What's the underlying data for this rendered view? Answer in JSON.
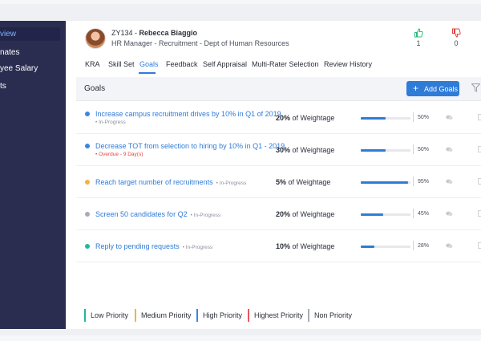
{
  "sidebar": {
    "items": [
      {
        "label": "view",
        "active": true
      },
      {
        "label": "nates",
        "active": false
      },
      {
        "label": "yee Salary",
        "active": false
      },
      {
        "label": "ts",
        "active": false
      }
    ]
  },
  "employee": {
    "id": "ZY134",
    "separator": " - ",
    "name": "Rebecca Biaggio",
    "role": "HR Manager - Recruitment - Dept of Human Resources"
  },
  "feedback": {
    "likes": "1",
    "dislikes": "0"
  },
  "tabs": [
    {
      "label": "KRA"
    },
    {
      "label": "Skill Set"
    },
    {
      "label": "Goals",
      "active": true
    },
    {
      "label": "Feedback"
    },
    {
      "label": "Self Appraisal"
    },
    {
      "label": "Multi-Rater Selection"
    },
    {
      "label": "Review History"
    }
  ],
  "goals_section": {
    "title": "Goals",
    "add_button_label": "Add Goals",
    "add_button_icon": "+"
  },
  "goals": [
    {
      "title": "Increase campus recruitment drives by 10% in Q1 of 2019.",
      "status": "In-Progress",
      "status_type": "normal",
      "status_inline": false,
      "weight_value": "20%",
      "weight_suffix": " of Weightage",
      "progress": 0.5,
      "progress_label": "50%",
      "priority_color": "#3b86e0"
    },
    {
      "title": "Decrease TOT from selection to hiring by 10% in Q1 - 2019.",
      "status": "Overdue - 9 Day(s)",
      "status_type": "overdue",
      "status_inline": false,
      "weight_value": "30%",
      "weight_suffix": " of Weightage",
      "progress": 0.5,
      "progress_label": "50%",
      "priority_color": "#3b86e0"
    },
    {
      "title": "Reach target number of recruitments",
      "status": "In-Progress",
      "status_type": "normal",
      "status_inline": true,
      "weight_value": "5%",
      "weight_suffix": " of Weightage",
      "progress": 0.95,
      "progress_label": "95%",
      "priority_color": "#f3b33d"
    },
    {
      "title": "Screen 50 candidates for Q2",
      "status": "In-Progress",
      "status_type": "normal",
      "status_inline": true,
      "weight_value": "20%",
      "weight_suffix": " of Weightage",
      "progress": 0.45,
      "progress_label": "45%",
      "priority_color": "#a7adb5"
    },
    {
      "title": "Reply to pending requests",
      "status": "In-Progress",
      "status_type": "normal",
      "status_inline": true,
      "weight_value": "10%",
      "weight_suffix": " of Weightage",
      "progress": 0.28,
      "progress_label": "28%",
      "priority_color": "#1fb99a"
    }
  ],
  "legend": [
    {
      "label": "Low Priority",
      "color": "#1fb99a"
    },
    {
      "label": "Medium Priority",
      "color": "#f3b33d"
    },
    {
      "label": "High Priority",
      "color": "#3b86e0"
    },
    {
      "label": "Highest Priority",
      "color": "#e8555f"
    },
    {
      "label": "Non Priority",
      "color": "#a7adb5"
    }
  ],
  "colors": {
    "accent": "#2f7bd8",
    "sidebar_bg": "#2b2d50",
    "like": "#2db87d",
    "dislike": "#e0443e",
    "overdue": "#e0443e"
  }
}
